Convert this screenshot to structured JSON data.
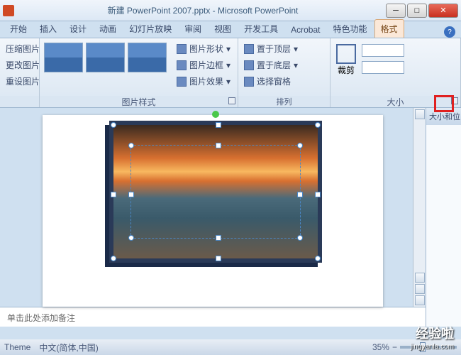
{
  "titlebar": {
    "title": "新建 PowerPoint 2007.pptx - Microsoft PowerPoint"
  },
  "tabs": {
    "items": [
      {
        "label": "开始"
      },
      {
        "label": "插入"
      },
      {
        "label": "设计"
      },
      {
        "label": "动画"
      },
      {
        "label": "幻灯片放映"
      },
      {
        "label": "审阅"
      },
      {
        "label": "视图"
      },
      {
        "label": "开发工具"
      },
      {
        "label": "Acrobat"
      },
      {
        "label": "特色功能"
      },
      {
        "label": "格式"
      }
    ],
    "help": "?"
  },
  "ribbon": {
    "adjust": {
      "compress": "压缩图片",
      "change": "更改图片",
      "reset": "重设图片"
    },
    "styles": {
      "label": "图片样式",
      "shape": "图片形状",
      "border": "图片边框",
      "effects": "图片效果"
    },
    "arrange": {
      "label": "排列",
      "front": "置于顶层",
      "back": "置于底层",
      "pane": "选择窗格"
    },
    "size": {
      "label": "大小",
      "crop": "裁剪"
    }
  },
  "side_panel": {
    "title": "大小和位"
  },
  "notes": {
    "placeholder": "单击此处添加备注"
  },
  "statusbar": {
    "lang": "中文(简体,中国)",
    "zoom": "35%"
  },
  "watermark": {
    "brand": "经验啦",
    "url": "jingyanla.com"
  }
}
